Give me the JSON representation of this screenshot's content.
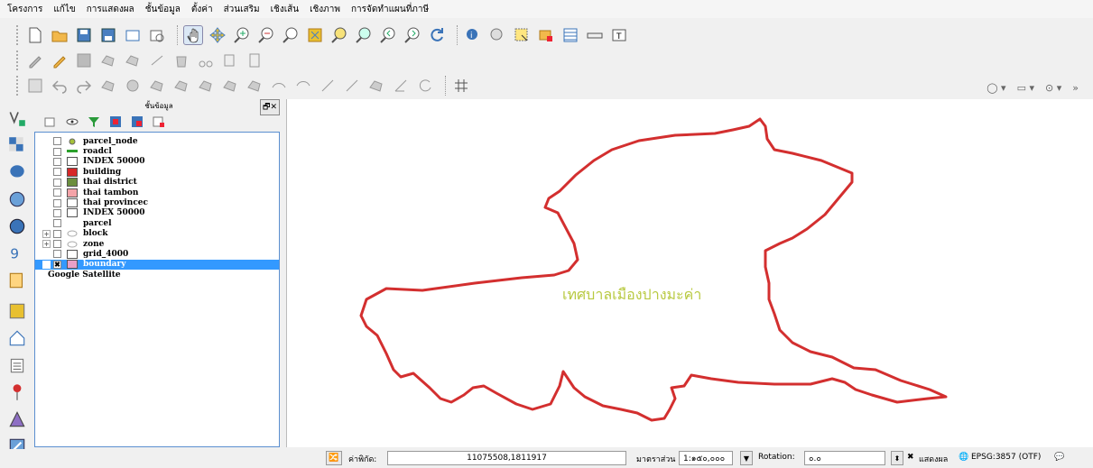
{
  "menu": [
    "โครงการ",
    "แก้ไข",
    "การแสดงผล",
    "ชั้นข้อมูล",
    "ตั้งค่า",
    "ส่วนเสริม",
    "เชิงเส้น",
    "เชิงภาพ",
    "การจัดทำแผนที่ภาษี"
  ],
  "panel": {
    "title": "ชั้นข้อมูล",
    "close_label": "🗗✕"
  },
  "layers": [
    {
      "name": "parcel_node",
      "symbol": "point",
      "color": "#a6c23a",
      "expand": false,
      "checked": false
    },
    {
      "name": "roadcl",
      "symbol": "line",
      "color": "#2ca02c",
      "expand": false,
      "checked": false
    },
    {
      "name": "INDEX 50000",
      "symbol": "box",
      "color": "#ffffff",
      "expand": false,
      "checked": false
    },
    {
      "name": "building",
      "symbol": "box",
      "color": "#d62728",
      "expand": false,
      "checked": false
    },
    {
      "name": "thai district",
      "symbol": "box",
      "color": "#6b8e3e",
      "expand": false,
      "checked": false
    },
    {
      "name": "thai tambon",
      "symbol": "box",
      "color": "#f4a3a8",
      "expand": false,
      "checked": false
    },
    {
      "name": "thai provincec",
      "symbol": "box",
      "color": "#ffffff",
      "expand": false,
      "checked": false
    },
    {
      "name": "INDEX 50000",
      "symbol": "box",
      "color": "#ffffff",
      "expand": false,
      "checked": false
    },
    {
      "name": "parcel",
      "symbol": "none",
      "color": "#ffffff",
      "expand": false,
      "checked": false
    },
    {
      "name": "block",
      "symbol": "group",
      "color": "#cccccc",
      "expand": true,
      "checked": false
    },
    {
      "name": "zone",
      "symbol": "group",
      "color": "#cccccc",
      "expand": true,
      "checked": false
    },
    {
      "name": "grid_4000",
      "symbol": "box",
      "color": "#ffffff",
      "expand": false,
      "checked": false
    },
    {
      "name": "boundary",
      "symbol": "box",
      "color": "#e8a0c8",
      "expand": false,
      "checked": true,
      "selected": true
    },
    {
      "name": "Google Satellite",
      "symbol": "none",
      "color": "#ffffff",
      "expand": false,
      "checked": false,
      "top": true
    }
  ],
  "map": {
    "label": "เทศบาลเมืองปางมะค่า",
    "boundary_color": "#d32f2f"
  },
  "status": {
    "coord_label": "ค่าพิกัด:",
    "coord_value": "11075508,1811917",
    "scale_label": "มาตราส่วน",
    "scale_value": "1:๑๕๐,๐๐๐",
    "rotation_label": "Rotation:",
    "rotation_value": "๐.๐",
    "render_label": "แสดงผล",
    "crs": "EPSG:3857 (OTF)"
  },
  "colors": {
    "selection": "#3399ff",
    "panel_border": "#5b8fd0"
  }
}
